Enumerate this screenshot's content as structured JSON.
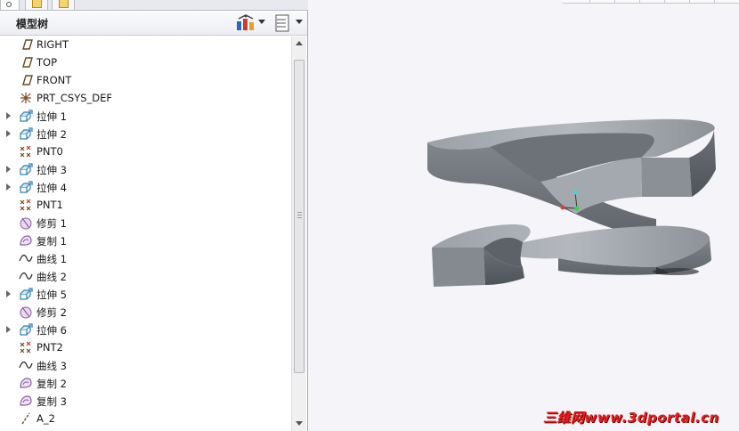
{
  "model_tree": {
    "title": "模型树",
    "settings_icon": "tree-settings-icon",
    "show_icon": "show-list-icon",
    "items": [
      {
        "label": "RIGHT",
        "icon": "datum-plane-icon",
        "expandable": false
      },
      {
        "label": "TOP",
        "icon": "datum-plane-icon",
        "expandable": false
      },
      {
        "label": "FRONT",
        "icon": "datum-plane-icon",
        "expandable": false
      },
      {
        "label": "PRT_CSYS_DEF",
        "icon": "coordinate-system-icon",
        "expandable": false
      },
      {
        "label": "拉伸 1",
        "icon": "extrude-icon",
        "expandable": true
      },
      {
        "label": "拉伸 2",
        "icon": "extrude-icon",
        "expandable": true
      },
      {
        "label": "PNT0",
        "icon": "datum-point-icon",
        "expandable": false
      },
      {
        "label": "拉伸 3",
        "icon": "extrude-icon",
        "expandable": true
      },
      {
        "label": "拉伸 4",
        "icon": "extrude-icon",
        "expandable": true
      },
      {
        "label": "PNT1",
        "icon": "datum-point-icon",
        "expandable": false
      },
      {
        "label": "修剪 1",
        "icon": "trim-icon",
        "expandable": false
      },
      {
        "label": "复制 1",
        "icon": "copy-surface-icon",
        "expandable": false
      },
      {
        "label": "曲线 1",
        "icon": "curve-icon",
        "expandable": false
      },
      {
        "label": "曲线 2",
        "icon": "curve-icon",
        "expandable": false
      },
      {
        "label": "拉伸 5",
        "icon": "extrude-icon",
        "expandable": true
      },
      {
        "label": "修剪 2",
        "icon": "trim-icon",
        "expandable": false
      },
      {
        "label": "拉伸 6",
        "icon": "extrude-icon",
        "expandable": true
      },
      {
        "label": "PNT2",
        "icon": "datum-point-icon",
        "expandable": false
      },
      {
        "label": "曲线 3",
        "icon": "curve-icon",
        "expandable": false
      },
      {
        "label": "复制 2",
        "icon": "copy-surface-icon",
        "expandable": false
      },
      {
        "label": "复制 3",
        "icon": "copy-surface-icon",
        "expandable": false
      },
      {
        "label": "A_2",
        "icon": "datum-axis-icon",
        "expandable": false
      }
    ]
  },
  "viewport": {
    "model_color": "#7b8087",
    "background": "#f5f5f9"
  },
  "watermark": "三维网www.3dportal.cn"
}
